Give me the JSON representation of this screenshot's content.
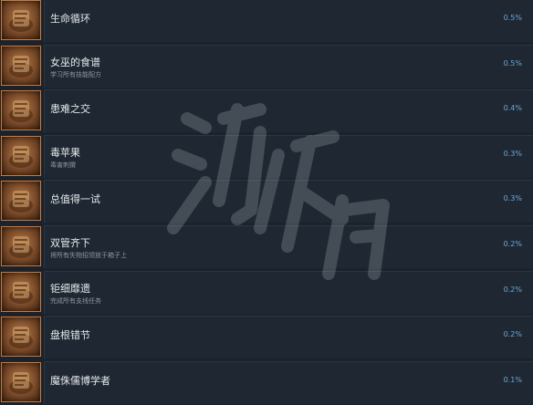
{
  "achievements": [
    {
      "title": "生命循环",
      "desc": "",
      "percent": "0.5%",
      "icon": "book-pile-icon"
    },
    {
      "title": "女巫的食谱",
      "desc": "学习所有技能配方",
      "percent": "0.5%",
      "icon": "recipe-scroll-icon"
    },
    {
      "title": "患难之交",
      "desc": "",
      "percent": "0.4%",
      "icon": "hands-friendship-icon"
    },
    {
      "title": "毒苹果",
      "desc": "毒害刺猬",
      "percent": "0.3%",
      "icon": "poison-apple-icon"
    },
    {
      "title": "总值得一试",
      "desc": "",
      "percent": "0.3%",
      "icon": "candle-flame-icon"
    },
    {
      "title": "双管齐下",
      "desc": "将所有失物招领放于箱子上",
      "percent": "0.2%",
      "icon": "crossed-tools-icon"
    },
    {
      "title": "钜细靡遗",
      "desc": "完成所有支线任务",
      "percent": "0.2%",
      "icon": "open-map-icon"
    },
    {
      "title": "盘根错节",
      "desc": "",
      "percent": "0.2%",
      "icon": "tangled-roots-icon"
    },
    {
      "title": "魔侏儒博学者",
      "desc": "",
      "percent": "0.1%",
      "icon": "gnome-scholar-icon"
    }
  ],
  "watermark": {
    "text": "游侠网"
  }
}
